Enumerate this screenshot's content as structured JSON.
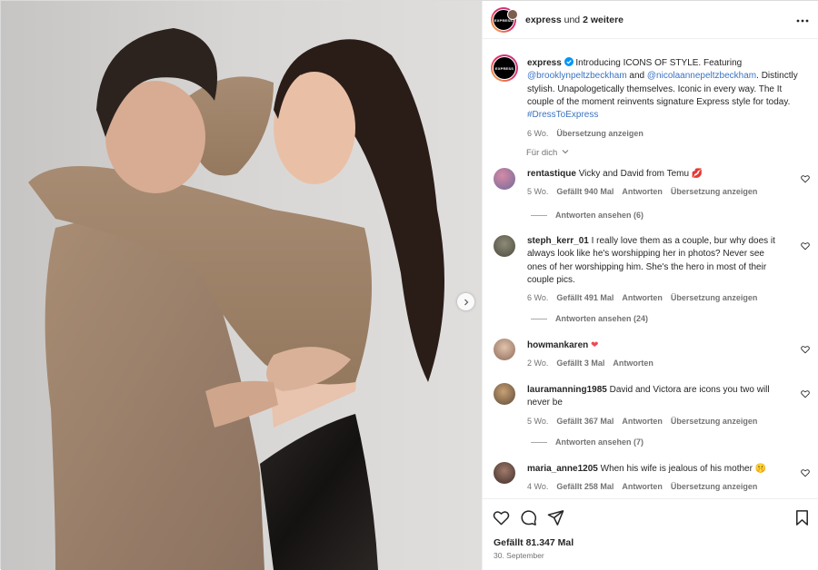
{
  "header": {
    "username": "express",
    "suffix_pre": "und",
    "suffix_bold": "2 weitere",
    "avatar_text": "EXPRESS"
  },
  "caption": {
    "username": "express",
    "text1": " Introducing ICONS OF STYLE. Featuring ",
    "mention1": "@brooklynpeltzbeckham",
    "text2": " and ",
    "mention2": "@nicolaannepeltzbeckham",
    "text3": ". Distinctly stylish. Unapologetically themselves. Iconic in every way. The It couple of the moment reinvents signature Express style for today. ",
    "hashtag": "#DressToExpress",
    "time": "6 Wo.",
    "translate": "Übersetzung anzeigen"
  },
  "for_you": "Für dich",
  "comments": [
    {
      "username": "rentastique",
      "text": "Vicky and David from Temu",
      "emoji": "💋",
      "time": "5 Wo.",
      "likes": "Gefällt 940 Mal",
      "reply": "Antworten",
      "translate": "Übersetzung anzeigen",
      "replies": "Antworten ansehen (6)"
    },
    {
      "username": "steph_kerr_01",
      "text": "I really love them as a couple, bur why does it always look like he's worshipping her in photos? Never see ones of her worshipping him. She's the hero in most of their couple pics.",
      "emoji": "",
      "time": "6 Wo.",
      "likes": "Gefällt 491 Mal",
      "reply": "Antworten",
      "translate": "Übersetzung anzeigen",
      "replies": "Antworten ansehen (24)"
    },
    {
      "username": "howmankaren",
      "text": "",
      "emoji": "❤",
      "time": "2 Wo.",
      "likes": "Gefällt 3 Mal",
      "reply": "Antworten",
      "translate": "",
      "replies": ""
    },
    {
      "username": "lauramanning1985",
      "text": "David and Victora are icons you two will never be",
      "emoji": "",
      "time": "5 Wo.",
      "likes": "Gefällt 367 Mal",
      "reply": "Antworten",
      "translate": "Übersetzung anzeigen",
      "replies": "Antworten ansehen (7)"
    },
    {
      "username": "maria_anne1205",
      "text": "When his wife is jealous of his mother",
      "emoji": "🤫",
      "time": "4 Wo.",
      "likes": "Gefällt 258 Mal",
      "reply": "Antworten",
      "translate": "Übersetzung anzeigen",
      "replies": ""
    }
  ],
  "footer": {
    "likes": "Gefällt 81.347 Mal",
    "date": "30. September"
  },
  "icons": [
    "heart-icon",
    "comment-icon",
    "share-icon",
    "bookmark-icon",
    "more-icon",
    "verified-icon",
    "chevron-right-icon"
  ],
  "colors": {
    "link": "#3b73c2",
    "verified": "#0095f6",
    "heart_red": "#ed4956",
    "muted": "#737373"
  }
}
